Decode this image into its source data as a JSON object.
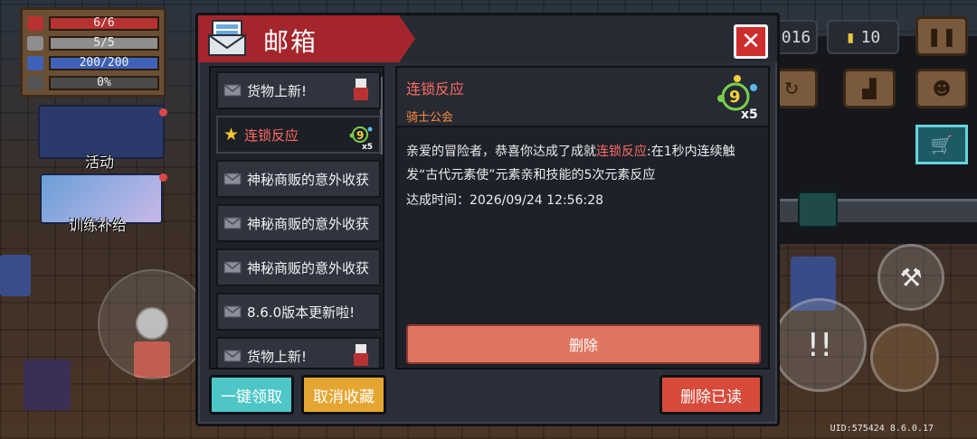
{
  "hud": {
    "stats": [
      {
        "icon": "heart-icon",
        "value": "6/6",
        "fill": 1.0,
        "color": "#b83232"
      },
      {
        "icon": "shield-icon",
        "value": "5/5",
        "fill": 1.0,
        "color": "#8e8e8e"
      },
      {
        "icon": "energy-icon",
        "value": "200/200",
        "fill": 1.0,
        "color": "#3d62b8"
      },
      {
        "icon": "skill-icon",
        "value": "0%",
        "fill": 0.0,
        "color": "#555555"
      }
    ],
    "activity_label": "活动",
    "training_label": "训练补给",
    "gem_count": "016",
    "coin_count": "10",
    "uid": "UID:575424 8.6.0.17"
  },
  "mailbox": {
    "title": "邮箱",
    "mail_list": [
      {
        "label": "货物上新!",
        "icon": "envelope-icon",
        "thumb": "merchant-icon",
        "selected": false
      },
      {
        "label": "连锁反应",
        "icon": "star-icon",
        "thumb": "chain-reaction-badge-icon",
        "selected": true
      },
      {
        "label": "神秘商贩的意外收获",
        "icon": "envelope-icon",
        "selected": false
      },
      {
        "label": "神秘商贩的意外收获",
        "icon": "envelope-icon",
        "selected": false
      },
      {
        "label": "神秘商贩的意外收获",
        "icon": "envelope-icon",
        "selected": false
      },
      {
        "label": "8.6.0版本更新啦!",
        "icon": "envelope-icon",
        "selected": false
      },
      {
        "label": "货物上新!",
        "icon": "envelope-icon",
        "thumb": "merchant-icon",
        "selected": false
      }
    ],
    "detail": {
      "title": "连锁反应",
      "sender": "骑士公会",
      "body_pre": "亲爱的冒险者，恭喜你达成了成就",
      "body_highlight": "连锁反应",
      "body_post": ":在1秒内连续触发“古代元素使”元素亲和技能的5次元素反应",
      "time_label": "达成时间：",
      "time_value": "2026/09/24 12:56:28",
      "delete_label": "删除"
    },
    "buttons": {
      "claim_all": "一键领取",
      "unfavorite": "取消收藏",
      "delete_read": "删除已读"
    }
  }
}
